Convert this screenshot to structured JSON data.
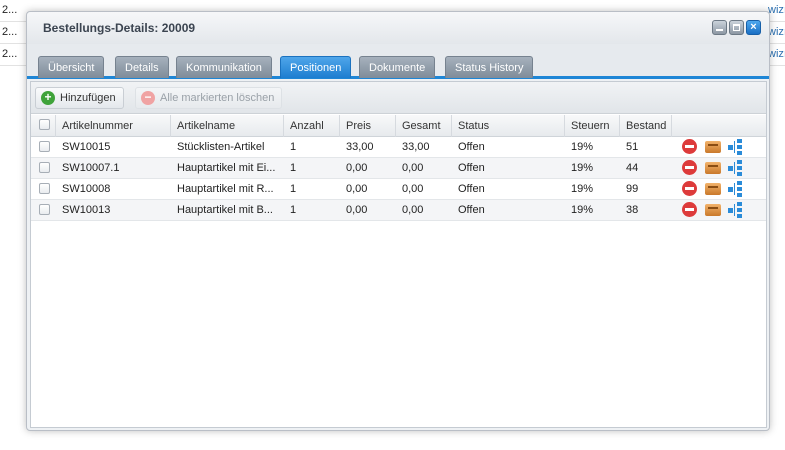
{
  "background_rows": [
    {
      "left": "2...",
      "right": "wizı"
    },
    {
      "left": "2...",
      "right": "wizı"
    },
    {
      "left": "2...",
      "right": "wizı"
    }
  ],
  "window": {
    "title": "Bestellungs-Details: 20009",
    "tools": [
      "minimize-icon",
      "maximize-icon",
      "close-icon"
    ]
  },
  "tabs": [
    {
      "label": "Übersicht",
      "active": false
    },
    {
      "label": "Details",
      "active": false
    },
    {
      "label": "Kommunikation",
      "active": false
    },
    {
      "label": "Positionen",
      "active": true
    },
    {
      "label": "Dokumente",
      "active": false
    },
    {
      "label": "Status History",
      "active": false
    }
  ],
  "toolbar": {
    "add_label": "Hinzufügen",
    "delete_label": "Alle markierten löschen"
  },
  "grid": {
    "columns": [
      "Artikelnummer",
      "Artikelname",
      "Anzahl",
      "Preis",
      "Gesamt",
      "Status",
      "Steuern",
      "Bestand"
    ],
    "rows": [
      [
        "SW10015",
        "Stücklisten-Artikel",
        "1",
        "33,00",
        "33,00",
        "Offen",
        "19%",
        "51"
      ],
      [
        "SW10007.1",
        "Hauptartikel mit Ei...",
        "1",
        "0,00",
        "0,00",
        "Offen",
        "19%",
        "44"
      ],
      [
        "SW10008",
        "Hauptartikel mit R...",
        "1",
        "0,00",
        "0,00",
        "Offen",
        "19%",
        "99"
      ],
      [
        "SW10013",
        "Hauptartikel mit B...",
        "1",
        "0,00",
        "0,00",
        "Offen",
        "19%",
        "38"
      ]
    ],
    "row_actions": [
      "delete-icon",
      "article-box-icon",
      "tree-icon"
    ]
  },
  "colors": {
    "accent": "#1e86d6",
    "delete": "#dd3b3b",
    "add": "#3fa33a"
  }
}
